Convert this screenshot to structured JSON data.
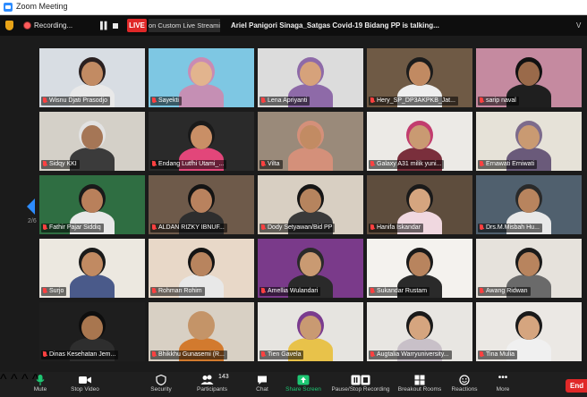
{
  "window": {
    "title": "Zoom Meeting"
  },
  "status": {
    "recording": "Recording...",
    "live": "LIVE",
    "streaming": "on Custom Live Streaming",
    "talking": "Ariel Panigori Sinaga_Satgas Covid-19 Bidang PP is talking...",
    "view": "V"
  },
  "pager": {
    "page": "2/6"
  },
  "participants": [
    {
      "name": "Wisnu Djati Prasodjo",
      "bg": "#d8dde3",
      "skin": "#c28b63",
      "shirt": "#e9e9e9",
      "hair": "#2a2020"
    },
    {
      "name": "Sayekti",
      "bg": "#7ec7e3",
      "skin": "#e2b48e",
      "shirt": "#c58fb4",
      "hair": "#c98bb3"
    },
    {
      "name": "Lena Apriyanti",
      "bg": "#dcdcdc",
      "skin": "#d6a27b",
      "shirt": "#8e6aa8",
      "hair": "#8e6aa8"
    },
    {
      "name": "Hery_SP_DP3AKPKB_Jat...",
      "bg": "#6f5a45",
      "skin": "#c18a62",
      "shirt": "#eeeeee",
      "hair": "#1c1c1c"
    },
    {
      "name": "sarip naval",
      "bg": "#c58aa0",
      "skin": "#9a6a4a",
      "shirt": "#1f1f1f",
      "hair": "#111111"
    },
    {
      "name": "Sidqy KKI",
      "bg": "#d4d0c8",
      "skin": "#a57656",
      "shirt": "#3b3b3b",
      "hair": "#e2e2e2"
    },
    {
      "name": "Endang Lutfhi Utami_...",
      "bg": "#2a2a2a",
      "skin": "#c98f66",
      "shirt": "#e2467a",
      "hair": "#1a1a1a"
    },
    {
      "name": "Vilta",
      "bg": "#9a8a7a",
      "skin": "#c28b63",
      "shirt": "#d4907a",
      "hair": "#d4907a"
    },
    {
      "name": "Galaxy A31 milik yuni...",
      "bg": "#eceae6",
      "skin": "#c99a72",
      "shirt": "#7a2f3c",
      "hair": "#c23c6e"
    },
    {
      "name": "Ernawati Erniwati",
      "bg": "#e6e2d8",
      "skin": "#c99a72",
      "shirt": "#6a5a7a",
      "hair": "#7d6b8c"
    },
    {
      "name": "Fathir Pajar Siddiq",
      "bg": "#2f6e42",
      "skin": "#b9805b",
      "shirt": "#e8e8e8",
      "hair": "#1a1a1a"
    },
    {
      "name": "ALDAN RIZKY IBNUF...",
      "bg": "#6e5a4a",
      "skin": "#b9825e",
      "shirt": "#2e2e2e",
      "hair": "#141414"
    },
    {
      "name": "Dody Setyawan/Bid PP",
      "bg": "#d8cfc2",
      "skin": "#b6845e",
      "shirt": "#3a3a3a",
      "hair": "#151515"
    },
    {
      "name": "Hanifa Iskandar",
      "bg": "#5e4d3d",
      "skin": "#d5a57f",
      "shirt": "#f0d8e0",
      "hair": "#1a1a1a"
    },
    {
      "name": "Drs.M.Misbah Hu...",
      "bg": "#50606e",
      "skin": "#b8845e",
      "shirt": "#e8e8e8",
      "hair": "#2a2a2a"
    },
    {
      "name": "Surjo",
      "bg": "#ece8e0",
      "skin": "#c18a62",
      "shirt": "#4a5a8a",
      "hair": "#1a1a1a"
    },
    {
      "name": "Rohman Rohim",
      "bg": "#e8d8c8",
      "skin": "#b8845e",
      "shirt": "#e8e8e8",
      "hair": "#141414"
    },
    {
      "name": "Amellia Wulandari",
      "bg": "#7a3a8a",
      "skin": "#c99a72",
      "shirt": "#2a2a2a",
      "hair": "#2a2a2a"
    },
    {
      "name": "Sukandar Rustam",
      "bg": "#f4f2ee",
      "skin": "#b8845e",
      "shirt": "#2a2a2a",
      "hair": "#1a1a1a"
    },
    {
      "name": "Awang Ridwan",
      "bg": "#e6e2dc",
      "skin": "#b8845e",
      "shirt": "#6a6a6a",
      "hair": "#1a1a1a"
    },
    {
      "name": "Dinas Kesehatan Jem...",
      "bg": "#1e1e1e",
      "skin": "#a8764f",
      "shirt": "#2e2e2e",
      "hair": "#0e0e0e"
    },
    {
      "name": "Bhikkhu Gunasemi (R...",
      "bg": "#d8d0c4",
      "skin": "#c49468",
      "shirt": "#d27a2e",
      "hair": "#c49468"
    },
    {
      "name": "Tien Gavela",
      "bg": "#e6e4e0",
      "skin": "#c99a72",
      "shirt": "#e8c24a",
      "hair": "#7a3b8e"
    },
    {
      "name": "Augtalia Warryuniversity...",
      "bg": "#e8e6e2",
      "skin": "#d5a57f",
      "shirt": "#c8c0c8",
      "hair": "#1a1a1a"
    },
    {
      "name": "Tina Mulia",
      "bg": "#ebe8e4",
      "skin": "#d5a57f",
      "shirt": "#f0f0f0",
      "hair": "#1a1a1a"
    }
  ],
  "toolbar": {
    "mute": "Mute",
    "video": "Stop Video",
    "security": "Security",
    "participants": "Participants",
    "participants_count": "143",
    "chat": "Chat",
    "share": "Share Screen",
    "recording": "Pause/Stop Recording",
    "breakout": "Breakout Rooms",
    "reactions": "Reactions",
    "more": "More",
    "end": "End"
  },
  "colors": {
    "accent": "#2d8cff",
    "live": "#e02828",
    "share": "#1ec773",
    "speaking": "#8bd34a"
  }
}
